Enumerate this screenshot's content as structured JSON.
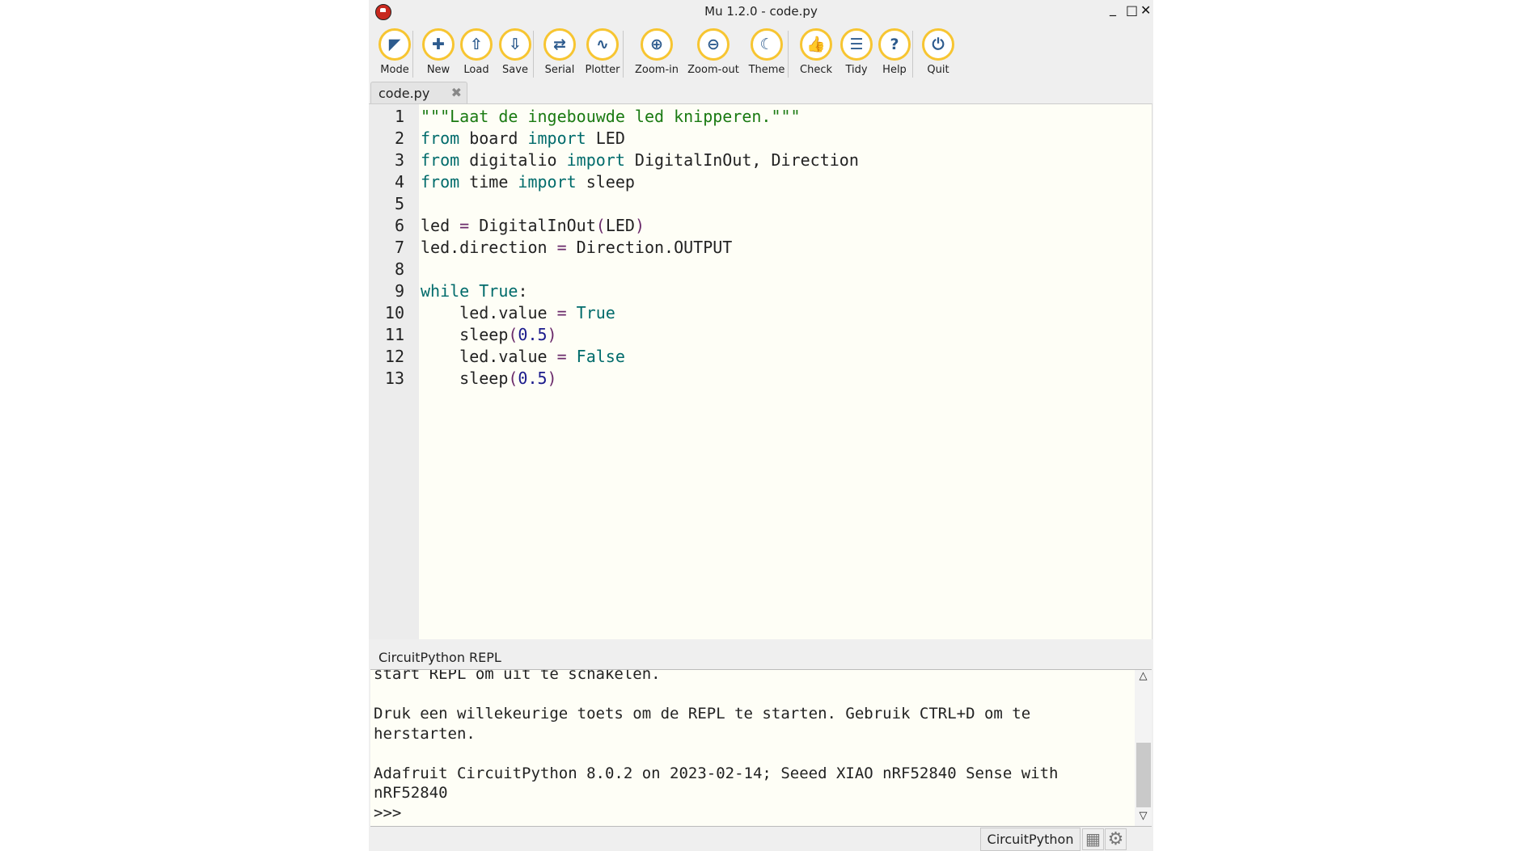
{
  "window": {
    "title": "Mu 1.2.0 - code.py",
    "controls": [
      "_",
      "□",
      "✕"
    ]
  },
  "toolbar": [
    {
      "id": "mode",
      "label": "Mode",
      "icon": "mode-icon",
      "glyph": "◤"
    },
    {
      "id": "new",
      "label": "New",
      "icon": "plus-icon",
      "glyph": "✚"
    },
    {
      "id": "load",
      "label": "Load",
      "icon": "upload-icon",
      "glyph": "⇧"
    },
    {
      "id": "save",
      "label": "Save",
      "icon": "download-icon",
      "glyph": "⇩"
    },
    {
      "id": "serial",
      "label": "Serial",
      "icon": "arrows-exchange-icon",
      "glyph": "⇄"
    },
    {
      "id": "plotter",
      "label": "Plotter",
      "icon": "pulse-icon",
      "glyph": "∿"
    },
    {
      "id": "zoom-in",
      "label": "Zoom-in",
      "icon": "zoom-in-icon",
      "glyph": "⊕"
    },
    {
      "id": "zoom-out",
      "label": "Zoom-out",
      "icon": "zoom-out-icon",
      "glyph": "⊖"
    },
    {
      "id": "theme",
      "label": "Theme",
      "icon": "moon-icon",
      "glyph": "☾"
    },
    {
      "id": "check",
      "label": "Check",
      "icon": "thumbs-up-icon",
      "glyph": "👍"
    },
    {
      "id": "tidy",
      "label": "Tidy",
      "icon": "lines-icon",
      "glyph": "☰"
    },
    {
      "id": "help",
      "label": "Help",
      "icon": "question-icon",
      "glyph": "?"
    },
    {
      "id": "quit",
      "label": "Quit",
      "icon": "power-icon",
      "glyph": "⏻"
    }
  ],
  "tab": {
    "label": "code.py",
    "close": "✖"
  },
  "editor": {
    "line_numbers": [
      "1",
      "2",
      "3",
      "4",
      "5",
      "6",
      "7",
      "8",
      "9",
      "10",
      "11",
      "12",
      "13"
    ],
    "lines": [
      [
        {
          "t": "\"\"\"Laat de ingebouwde led knipperen.\"\"\"",
          "c": "str"
        }
      ],
      [
        {
          "t": "from",
          "c": "kw"
        },
        {
          "t": " board "
        },
        {
          "t": "import",
          "c": "kw"
        },
        {
          "t": " LED"
        }
      ],
      [
        {
          "t": "from",
          "c": "kw"
        },
        {
          "t": " digitalio "
        },
        {
          "t": "import",
          "c": "kw"
        },
        {
          "t": " DigitalInOut, Direction"
        }
      ],
      [
        {
          "t": "from",
          "c": "kw"
        },
        {
          "t": " time "
        },
        {
          "t": "import",
          "c": "kw"
        },
        {
          "t": " sleep"
        }
      ],
      [],
      [
        {
          "t": "led "
        },
        {
          "t": "=",
          "c": "op"
        },
        {
          "t": " DigitalInOut"
        },
        {
          "t": "(",
          "c": "op"
        },
        {
          "t": "LED"
        },
        {
          "t": ")",
          "c": "op"
        }
      ],
      [
        {
          "t": "led.direction "
        },
        {
          "t": "=",
          "c": "op"
        },
        {
          "t": " Direction.OUTPUT"
        }
      ],
      [],
      [
        {
          "t": "while",
          "c": "kw"
        },
        {
          "t": " "
        },
        {
          "t": "True",
          "c": "kw"
        },
        {
          "t": ":"
        }
      ],
      [
        {
          "t": "    led.value "
        },
        {
          "t": "=",
          "c": "op"
        },
        {
          "t": " "
        },
        {
          "t": "True",
          "c": "kw"
        }
      ],
      [
        {
          "t": "    sleep"
        },
        {
          "t": "(",
          "c": "op"
        },
        {
          "t": "0.5",
          "c": "num"
        },
        {
          "t": ")",
          "c": "op"
        }
      ],
      [
        {
          "t": "    led.value "
        },
        {
          "t": "=",
          "c": "op"
        },
        {
          "t": " "
        },
        {
          "t": "False",
          "c": "kw"
        }
      ],
      [
        {
          "t": "    sleep"
        },
        {
          "t": "(",
          "c": "op"
        },
        {
          "t": "0.5",
          "c": "num"
        },
        {
          "t": ")",
          "c": "op"
        }
      ]
    ]
  },
  "repl": {
    "label": "CircuitPython REPL",
    "lines": [
      "start REPL om uit te schakelen.",
      "",
      "Druk een willekeurige toets om de REPL te starten. Gebruik CTRL+D om te",
      "herstarten.",
      "",
      "Adafruit CircuitPython 8.0.2 on 2023-02-14; Seeed XIAO nRF52840 Sense with",
      "nRF52840",
      ">>>"
    ],
    "scroll_up": "△",
    "scroll_down": "▽"
  },
  "status": {
    "mode": "CircuitPython",
    "chip_glyph": "▦",
    "gear_glyph": "⚙"
  },
  "colors": {
    "accent": "#f7c531",
    "icon": "#2d5b8e",
    "keyword": "#006b6b",
    "string": "#1a7a12",
    "number": "#1a1a8c"
  }
}
